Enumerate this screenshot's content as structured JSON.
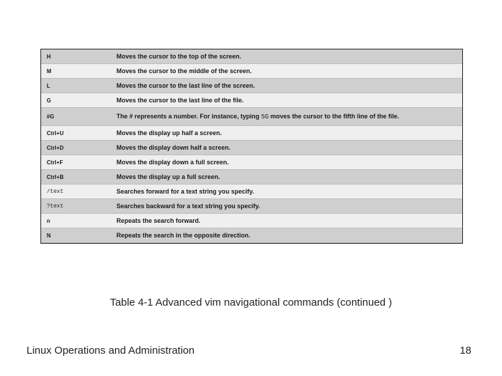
{
  "rows": [
    {
      "cmd": "H",
      "desc": "Moves the cursor to the top of the screen.",
      "mono": false
    },
    {
      "cmd": "M",
      "desc": "Moves the cursor to the middle of the screen.",
      "mono": false
    },
    {
      "cmd": "L",
      "desc": "Moves the cursor to the last line of the screen.",
      "mono": false
    },
    {
      "cmd": "G",
      "desc": "Moves the cursor to the last line of the file.",
      "mono": false
    },
    {
      "cmd": "#G",
      "desc_pre": "The # represents a number. For instance, typing ",
      "desc_code": "5G",
      "desc_post": " moves the cursor to the fifth line of the file.",
      "mono": false,
      "multiline": true
    },
    {
      "cmd": "Ctrl+U",
      "desc": "Moves the display up half a screen.",
      "mono": false
    },
    {
      "cmd": "Ctrl+D",
      "desc": "Moves the display down half a screen.",
      "mono": false
    },
    {
      "cmd": "Ctrl+F",
      "desc": "Moves the display down a full screen.",
      "mono": false
    },
    {
      "cmd": "Ctrl+B",
      "desc": "Moves the display up a full screen.",
      "mono": false
    },
    {
      "cmd": "/text",
      "desc": "Searches forward for a text string you specify.",
      "mono": true
    },
    {
      "cmd": "?text",
      "desc": "Searches backward for a text string you specify.",
      "mono": true
    },
    {
      "cmd": "n",
      "desc": "Repeats the search forward.",
      "mono": false
    },
    {
      "cmd": "N",
      "desc": "Repeats the search in the opposite direction.",
      "mono": false
    }
  ],
  "caption": "Table 4-1 Advanced vim navigational commands (continued )",
  "footer_left": "Linux Operations and Administration",
  "footer_right": "18"
}
